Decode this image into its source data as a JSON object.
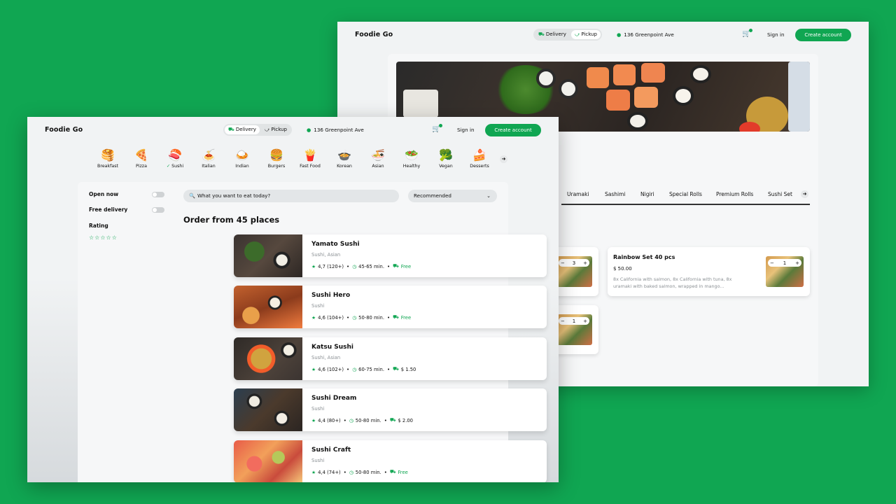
{
  "back_window": {
    "logo_main": "Foodie",
    "logo_accent": "Go",
    "mode_delivery": "Delivery",
    "mode_pickup": "Pickup",
    "address": "136 Greenpoint Ave",
    "sign_in": "Sign in",
    "create_account": "Create account",
    "menu_tabs": [
      "Uramaki",
      "Sashimi",
      "Nigiri",
      "Special Rolls",
      "Premium Rolls",
      "Sushi Set"
    ],
    "dish": {
      "name": "Rainbow Set 40 pcs",
      "price": "$ 50.00",
      "desc_line1": "8x California with salmon, 8x California with tuna, 8x",
      "desc_line2": "uramaki with baked salmon, wrapped in mango...",
      "qty": "1"
    },
    "left_card_qty_top": "3",
    "left_card_qty_bottom": "1"
  },
  "front_window": {
    "logo_main": "Foodie",
    "logo_accent": "Go",
    "mode_delivery": "Delivery",
    "mode_pickup": "Pickup",
    "address": "136 Greenpoint Ave",
    "sign_in": "Sign in",
    "create_account": "Create account",
    "categories": [
      {
        "label": "Breakfast",
        "icon": "pancakes-icon",
        "glyph": "🥞",
        "selected": false
      },
      {
        "label": "Pizza",
        "icon": "pizza-icon",
        "glyph": "🍕",
        "selected": false
      },
      {
        "label": "Sushi",
        "icon": "sushi-icon",
        "glyph": "🍣",
        "selected": true
      },
      {
        "label": "Italian",
        "icon": "pasta-icon",
        "glyph": "🍝",
        "selected": false
      },
      {
        "label": "Indian",
        "icon": "curry-icon",
        "glyph": "🍛",
        "selected": false
      },
      {
        "label": "Burgers",
        "icon": "burger-icon",
        "glyph": "🍔",
        "selected": false
      },
      {
        "label": "Fast Food",
        "icon": "fries-icon",
        "glyph": "🍟",
        "selected": false
      },
      {
        "label": "Korean",
        "icon": "bibimbap-icon",
        "glyph": "🍲",
        "selected": false
      },
      {
        "label": "Asian",
        "icon": "ramen-icon",
        "glyph": "🍜",
        "selected": false
      },
      {
        "label": "Healthy",
        "icon": "salad-icon",
        "glyph": "🥗",
        "selected": false
      },
      {
        "label": "Vegan",
        "icon": "vegetable-bowl-icon",
        "glyph": "🥦",
        "selected": false
      },
      {
        "label": "Desserts",
        "icon": "cake-icon",
        "glyph": "🍰",
        "selected": false
      }
    ],
    "filters": {
      "open_now": "Open now",
      "free_delivery": "Free delivery",
      "rating": "Rating",
      "stars": "☆☆☆☆☆"
    },
    "search_placeholder": "What you want to eat today?",
    "sort_value": "Recommended",
    "heading": "Order from 45 places",
    "restaurants": [
      {
        "name": "Yamato Sushi",
        "cuisine": "Sushi, Asian",
        "rating": "4,7 (120+)",
        "time": "45-65 min.",
        "fee": "Free",
        "fee_free": true
      },
      {
        "name": "Sushi Hero",
        "cuisine": "Sushi",
        "rating": "4,6 (104+)",
        "time": "50-80 min.",
        "fee": "Free",
        "fee_free": true
      },
      {
        "name": "Katsu Sushi",
        "cuisine": "Sushi, Asian",
        "rating": "4,6 (102+)",
        "time": "60-75 min.",
        "fee": "$ 1.50",
        "fee_free": false
      },
      {
        "name": "Sushi Dream",
        "cuisine": "Sushi",
        "rating": "4,4 (80+)",
        "time": "50-80 min.",
        "fee": "$ 2.00",
        "fee_free": false
      },
      {
        "name": "Sushi Craft",
        "cuisine": "Sushi",
        "rating": "4,4 (74+)",
        "time": "50-80 min.",
        "fee": "Free",
        "fee_free": true
      }
    ]
  },
  "colors": {
    "background": "#10a652",
    "accent": "#10a652",
    "panel": "#f6f7f8"
  }
}
